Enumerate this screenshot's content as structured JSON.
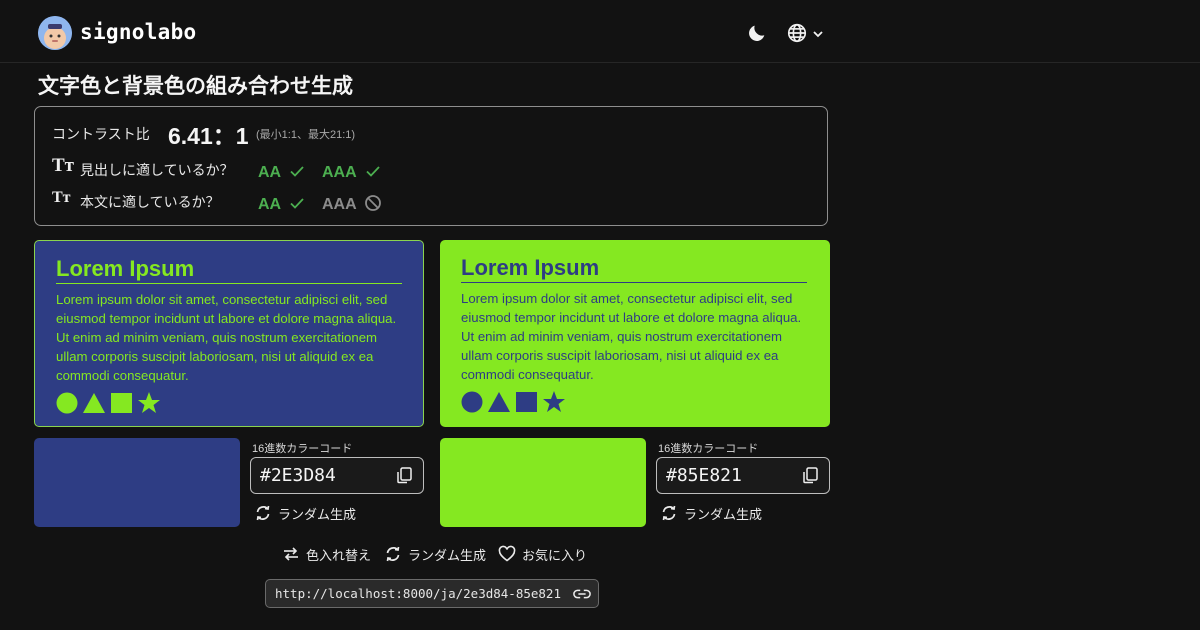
{
  "header": {
    "brand": "signolabo",
    "icons": [
      "avatar",
      "moon-icon",
      "globe-icon",
      "chevron-down-icon"
    ]
  },
  "page": {
    "title": "文字色と背景色の組み合わせ生成"
  },
  "contrast": {
    "label": "コントラスト比",
    "ratio": "6.41：1",
    "note": "(最小1:1、最大21:1)",
    "rows": [
      {
        "icon": "Tт",
        "question": "見出しに適しているか？",
        "aa": "AA",
        "aa_pass": true,
        "aaa": "AAA",
        "aaa_pass": true
      },
      {
        "icon": "Tт",
        "question": "本文に適しているか？",
        "aa": "AA",
        "aa_pass": true,
        "aaa": "AAA",
        "aaa_pass": false
      }
    ]
  },
  "preview": {
    "title": "Lorem Ipsum",
    "body": "Lorem ipsum dolor sit amet, consectetur adipisci elit, sed eiusmod tempor incidunt ut labore et dolore magna aliqua. Ut enim ad minim veniam, quis nostrum exercitationem ullam corporis suscipit laboriosam, nisi ut aliquid ex ea commodi consequatur.",
    "shapes": [
      "circle-icon",
      "triangle-icon",
      "square-icon",
      "star-icon"
    ]
  },
  "colors": {
    "text_color": "#2E3D84",
    "background_color": "#85E821",
    "hex_label": "16進数カラーコード",
    "random_label": "ランダム生成"
  },
  "actions": {
    "swap": "色入れ替え",
    "random": "ランダム生成",
    "favorite": "お気に入り"
  },
  "share": {
    "url": "http://localhost:8000/ja/2e3d84-85e821"
  }
}
